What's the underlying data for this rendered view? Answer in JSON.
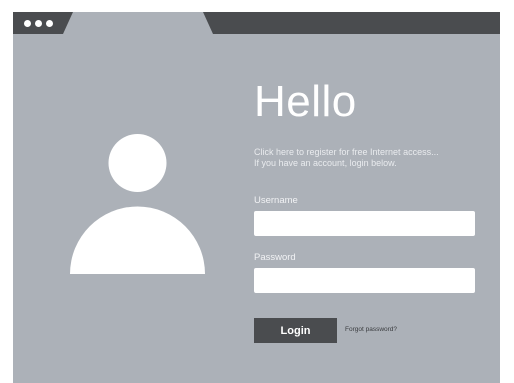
{
  "window": {
    "tab_label": ""
  },
  "login": {
    "heading": "Hello",
    "intro_line1": "Click here to register for free Internet access...",
    "intro_line2": "If you have an account, login below.",
    "username_label": "Username",
    "username_value": "",
    "password_label": "Password",
    "password_value": "",
    "login_button": "Login",
    "forgot_link": "Forgot password?"
  },
  "colors": {
    "titlebar": "#4a4c4f",
    "background": "#acb1b8",
    "button": "#4a4c4f"
  },
  "icons": {
    "avatar": "user-avatar-icon",
    "window_controls": "window-dots-icon"
  }
}
